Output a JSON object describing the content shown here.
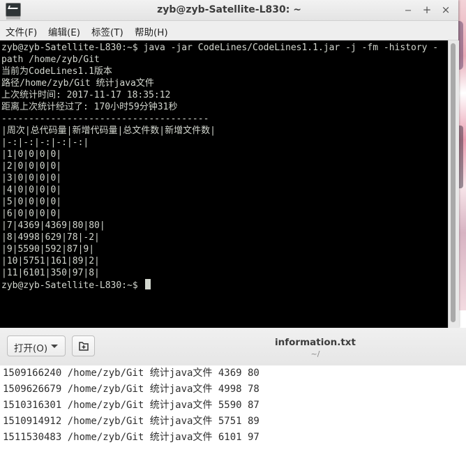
{
  "terminal": {
    "title": "zyb@zyb-Satellite-L830: ~",
    "buttons": {
      "minimize": "‒",
      "maximize": "+",
      "close": "×"
    },
    "menu": [
      "文件(F)",
      "编辑(E)",
      "标签(T)",
      "帮助(H)"
    ],
    "lines": [
      "zyb@zyb-Satellite-L830:~$ java -jar CodeLines/CodeLines1.1.jar -j -fm -history -",
      "path /home/zyb/Git",
      "当前为CodeLines1.1版本",
      "路径/home/zyb/Git 统计java文件",
      "上次统计时间: 2017-11-17 18:35:12",
      "距离上次统计经过了: 170小时59分钟31秒",
      "--------------------------------------",
      "|周次|总代码量|新增代码量|总文件数|新增文件数|",
      "|-:|-:|-:|-:|-:|",
      "|1|0|0|0|0|",
      "|2|0|0|0|0|",
      "|3|0|0|0|0|",
      "|4|0|0|0|0|",
      "|5|0|0|0|0|",
      "|6|0|0|0|0|",
      "|7|4369|4369|80|80|",
      "|8|4998|629|78|-2|",
      "|9|5590|592|87|9|",
      "|10|5751|161|89|2|",
      "|11|6101|350|97|8|",
      "zyb@zyb-Satellite-L830:~$ "
    ]
  },
  "editor": {
    "open_label": "打开(O)",
    "file_name": "information.txt",
    "file_path": "~/",
    "lines": [
      "1509166240 /home/zyb/Git 统计java文件 4369 80",
      "1509626679 /home/zyb/Git 统计java文件 4998 78",
      "1510316301 /home/zyb/Git 统计java文件 5590 87",
      "1510914912 /home/zyb/Git 统计java文件 5751 89",
      "1511530483 /home/zyb/Git 统计java文件 6101 97"
    ]
  },
  "icons": {
    "terminal_app": "terminal-icon",
    "open_dropdown": "chevron-down-icon",
    "new_document": "new-document-icon"
  }
}
